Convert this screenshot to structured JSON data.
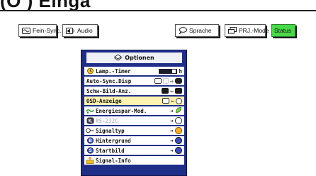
{
  "header": {
    "title": "(Ö ) Einga"
  },
  "toolbar": {
    "fein_sync": "Fein-Sync.",
    "audio": "Audio",
    "sprache": "Sprache",
    "prj_mode": "PRJ.-Mode",
    "status": "Status"
  },
  "menu": {
    "title": "Optionen",
    "items": [
      {
        "label": "Lamp.-Timer",
        "value": "h"
      },
      {
        "label": "Auto-Sync.Disp"
      },
      {
        "label": "Schw-Bild-Anz."
      },
      {
        "label": "OSD-Anzeige"
      },
      {
        "label": "Energiespar-Mod."
      },
      {
        "label": "RS-232C"
      },
      {
        "label": "Signaltyp"
      },
      {
        "label": "Hintergrund"
      },
      {
        "label": "Startbild"
      },
      {
        "label": "Signal-Info"
      }
    ],
    "selected_index": 3
  },
  "colors": {
    "window_bg": "#1f2e88",
    "highlight": "#fff3b0",
    "status_button": "#48d848",
    "accent_green": "#3cb83c",
    "accent_blue": "#3a4ac0"
  },
  "icons": [
    "fine-sync-icon",
    "speaker-icon",
    "speech-bubble-icon",
    "projector-icon",
    "options-icon",
    "lamp-icon",
    "arrow-icon",
    "plug-icon",
    "circle-letter-icon",
    "folder-icon"
  ]
}
